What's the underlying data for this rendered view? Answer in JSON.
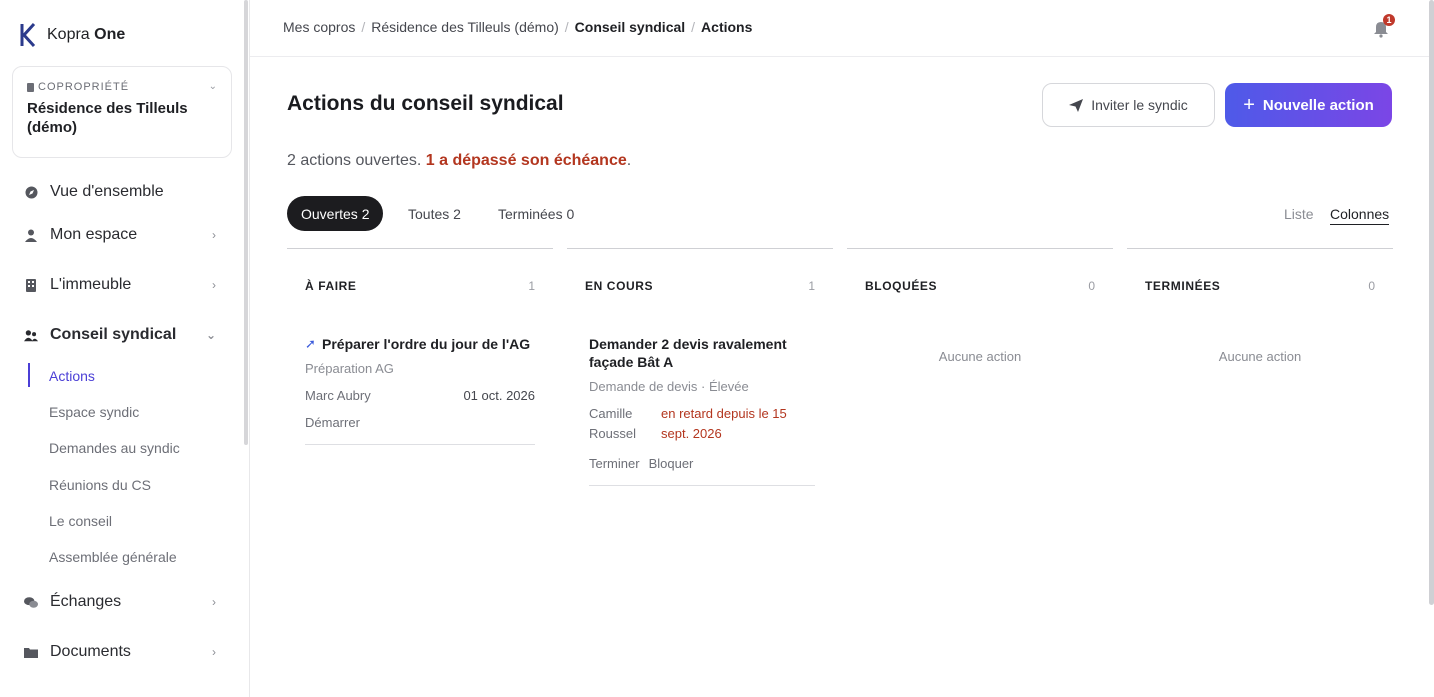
{
  "brand": {
    "name_prefix": "Kopra",
    "name_bold": "One"
  },
  "copro": {
    "kicker": "COPROPRIÉTÉ",
    "name": "Résidence des Tilleuls (démo)"
  },
  "nav": {
    "overview": "Vue d'ensemble",
    "my_space": "Mon espace",
    "building": "L'immeuble",
    "council": "Conseil syndical",
    "exchanges": "Échanges",
    "documents": "Documents"
  },
  "subnav": {
    "actions": "Actions",
    "syndic_space": "Espace syndic",
    "syndic_requests": "Demandes au syndic",
    "cs_meetings": "Réunions du CS",
    "the_council": "Le conseil",
    "general_assembly": "Assemblée générale"
  },
  "breadcrumb": [
    "Mes copros",
    "Résidence des Tilleuls (démo)",
    "Conseil syndical",
    "Actions"
  ],
  "notifications": {
    "count": "1"
  },
  "page": {
    "title": "Actions du conseil syndical",
    "invite_label": "Inviter le syndic",
    "new_action_label": "Nouvelle action",
    "summary_open": "2 actions ouvertes.",
    "summary_late": "1 a dépassé son échéance",
    "summary_end": "."
  },
  "filters": {
    "open": "Ouvertes 2",
    "all": "Toutes 2",
    "done": "Terminées 0"
  },
  "view": {
    "list": "Liste",
    "columns": "Colonnes"
  },
  "columns": [
    {
      "title": "À FAIRE",
      "count": "1"
    },
    {
      "title": "EN COURS",
      "count": "1"
    },
    {
      "title": "BLOQUÉES",
      "count": "0",
      "empty": "Aucune action"
    },
    {
      "title": "TERMINÉES",
      "count": "0",
      "empty": "Aucune action"
    }
  ],
  "cards": {
    "todo": {
      "title": "Préparer l'ordre du jour de l'AG",
      "category": "Préparation AG",
      "assignee": "Marc Aubry",
      "due": "01 oct. 2026",
      "action": "Démarrer"
    },
    "in_progress": {
      "title": "Demander 2 devis ravalement façade Bât A",
      "category": "Demande de devis · Élevée",
      "assignee": "Camille Roussel",
      "overdue": "en retard depuis le 15 sept. 2026",
      "action_finish": "Terminer",
      "action_block": "Bloquer"
    }
  },
  "colors": {
    "accent": "#4b3fd6",
    "danger": "#b3361f",
    "cta_start": "#4e5ae8",
    "cta_end": "#7b46e6"
  }
}
